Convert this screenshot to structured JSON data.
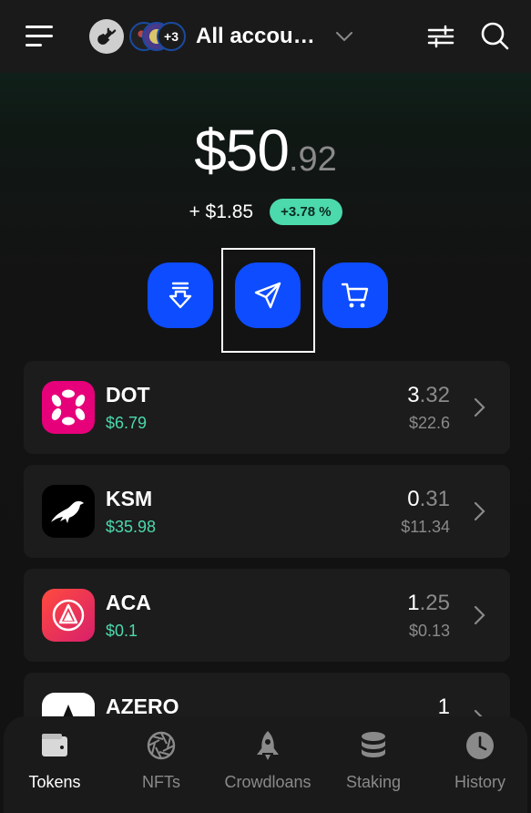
{
  "header": {
    "account_name": "All accou…",
    "extra_accounts_badge": "+3",
    "icons": [
      "menu-icon",
      "plug-icon",
      "chevron-down-icon",
      "filter-icon",
      "search-icon"
    ]
  },
  "balance": {
    "whole": "$50",
    "decimal": ".92",
    "change_value": "+ $1.85",
    "change_percent": "+3.78 %"
  },
  "actions": [
    {
      "name": "receive",
      "icon": "receive-icon"
    },
    {
      "name": "send",
      "icon": "send-icon"
    },
    {
      "name": "buy",
      "icon": "cart-icon"
    }
  ],
  "tokens": [
    {
      "symbol": "DOT",
      "price": "$6.79",
      "balance_whole": "3",
      "balance_decimal": ".32",
      "value": "$22.6",
      "logo_color": "#e6007a"
    },
    {
      "symbol": "KSM",
      "price": "$35.98",
      "balance_whole": "0",
      "balance_decimal": ".31",
      "value": "$11.34",
      "logo_color": "#000000"
    },
    {
      "symbol": "ACA",
      "price": "$0.1",
      "balance_whole": "1",
      "balance_decimal": ".25",
      "value": "$0.13",
      "logo_color": "#e83a4c"
    },
    {
      "symbol": "AZERO",
      "price": "",
      "balance_whole": "1",
      "balance_decimal": "",
      "value": "",
      "logo_color": "#ffffff"
    }
  ],
  "nav": {
    "tokens": "Tokens",
    "nfts": "NFTs",
    "crowdloans": "Crowdloans",
    "staking": "Staking",
    "history": "History"
  },
  "colors": {
    "accent": "#0d4cff",
    "positive": "#4cd9ac",
    "muted": "#8a8a8a"
  }
}
